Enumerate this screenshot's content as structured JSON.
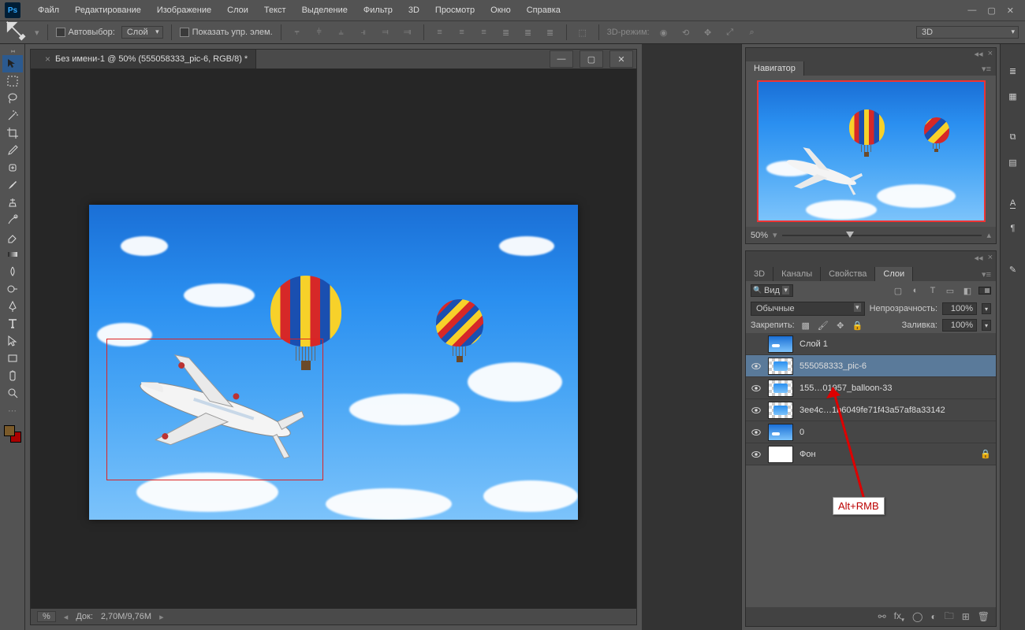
{
  "app": {
    "logo": "Ps"
  },
  "menu": {
    "items": [
      "Файл",
      "Редактирование",
      "Изображение",
      "Слои",
      "Текст",
      "Выделение",
      "Фильтр",
      "3D",
      "Просмотр",
      "Окно",
      "Справка"
    ]
  },
  "options": {
    "autoselect_label": "Автовыбор:",
    "autoselect_target": "Слой",
    "show_controls_label": "Показать упр. элем.",
    "mode3d_label": "3D-режим:",
    "mode3d_value": "3D"
  },
  "document": {
    "tab_title": "Без имени-1 @ 50% (555058333_pic-6, RGB/8) *",
    "status_zoom_suffix": "%",
    "status_doc_label": "Док:",
    "status_doc_value": "2,70M/9,76M"
  },
  "navigator": {
    "tab": "Навигатор",
    "zoom": "50%"
  },
  "layers_panel": {
    "tabs": [
      "3D",
      "Каналы",
      "Свойства",
      "Слои"
    ],
    "kind": "Вид",
    "blend_mode": "Обычные",
    "opacity_label": "Непрозрачность:",
    "opacity_value": "100%",
    "lock_label": "Закрепить:",
    "fill_label": "Заливка:",
    "fill_value": "100%",
    "layers": [
      {
        "name": "Слой 1",
        "visible": false,
        "locked": false,
        "selected": false,
        "thumb": "sky"
      },
      {
        "name": "555058333_pic-6",
        "visible": true,
        "locked": false,
        "selected": true,
        "thumb": "checker"
      },
      {
        "name": "155…01957_balloon-33",
        "visible": true,
        "locked": false,
        "selected": false,
        "thumb": "checker"
      },
      {
        "name": "3ee4c…1b6049fe71f43a57af8a33142",
        "visible": true,
        "locked": false,
        "selected": false,
        "thumb": "checker"
      },
      {
        "name": "0",
        "visible": true,
        "locked": false,
        "selected": false,
        "thumb": "sky"
      },
      {
        "name": "Фон",
        "visible": true,
        "locked": true,
        "selected": false,
        "thumb": "white"
      }
    ]
  },
  "annotation": {
    "text": "Alt+RMB"
  }
}
